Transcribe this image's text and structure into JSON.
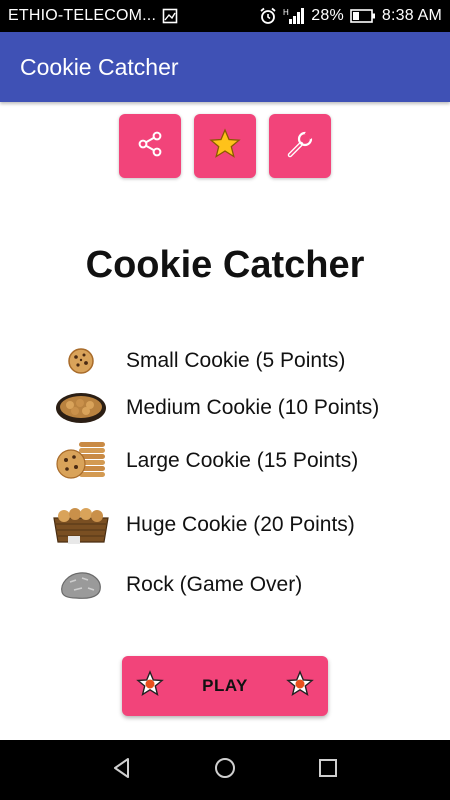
{
  "status_bar": {
    "carrier": "ETHIO-TELECOM...",
    "battery": "28%",
    "time": "8:38 AM",
    "icons": [
      "image-icon",
      "alarm-icon",
      "signal-icon",
      "battery-icon"
    ]
  },
  "app_bar": {
    "title": "Cookie Catcher"
  },
  "top_actions": [
    {
      "icon": "share-icon"
    },
    {
      "icon": "star-icon"
    },
    {
      "icon": "wrench-icon"
    }
  ],
  "main": {
    "title": "Cookie Catcher",
    "items": [
      {
        "label": "Small Cookie (5 Points)",
        "icon": "small-cookie-image"
      },
      {
        "label": "Medium Cookie (10 Points)",
        "icon": "medium-cookie-image"
      },
      {
        "label": "Large Cookie (15 Points)",
        "icon": "large-cookie-image"
      },
      {
        "label": "Huge Cookie (20 Points)",
        "icon": "huge-cookie-image"
      },
      {
        "label": "Rock (Game Over)",
        "icon": "rock-image"
      }
    ],
    "play_label": "PLAY"
  },
  "nav_bar": {
    "icons": [
      "back-icon",
      "home-icon",
      "recents-icon"
    ]
  },
  "colors": {
    "app_bar": "#3f51b5",
    "accent": "#f2447a",
    "status_bar": "#000000"
  }
}
